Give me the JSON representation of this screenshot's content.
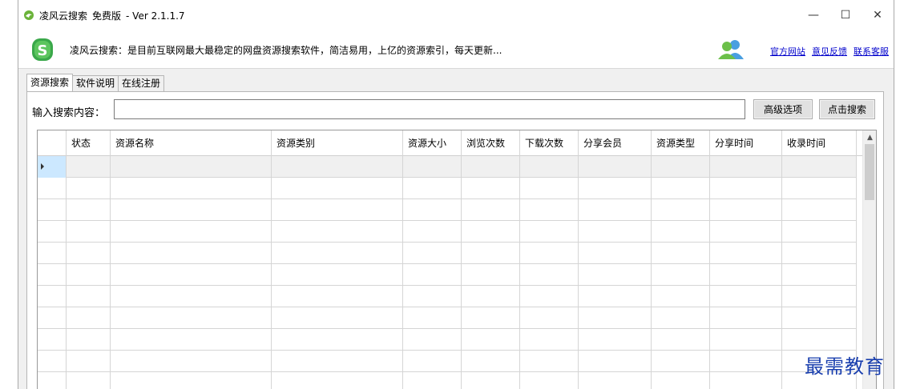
{
  "window": {
    "title_app": "凌风云搜索",
    "title_edition": "免费版",
    "title_version": "- Ver 2.1.1.7",
    "min_glyph": "—",
    "max_glyph": "☐",
    "close_glyph": "✕"
  },
  "banner": {
    "slogan": "凌风云搜索：是目前互联网最大最稳定的网盘资源搜索软件，简洁易用，上亿的资源索引，每天更新...",
    "links": [
      "官方网站",
      "意见反馈",
      "联系客服"
    ]
  },
  "tabs": [
    "资源搜索",
    "软件说明",
    "在线注册"
  ],
  "search": {
    "label": "输入搜索内容：",
    "value": "",
    "placeholder": "",
    "advanced_button": "高级选项",
    "search_button": "点击搜索"
  },
  "grid": {
    "columns": [
      "状态",
      "资源名称",
      "资源类别",
      "资源大小",
      "浏览次数",
      "下载次数",
      "分享会员",
      "资源类型",
      "分享时间",
      "收录时间"
    ],
    "rows": []
  },
  "watermark": "最需教育",
  "colors": {
    "link": "#0000cc",
    "selected_row_header": "#cce8ff",
    "watermark": "#1a3fae"
  }
}
